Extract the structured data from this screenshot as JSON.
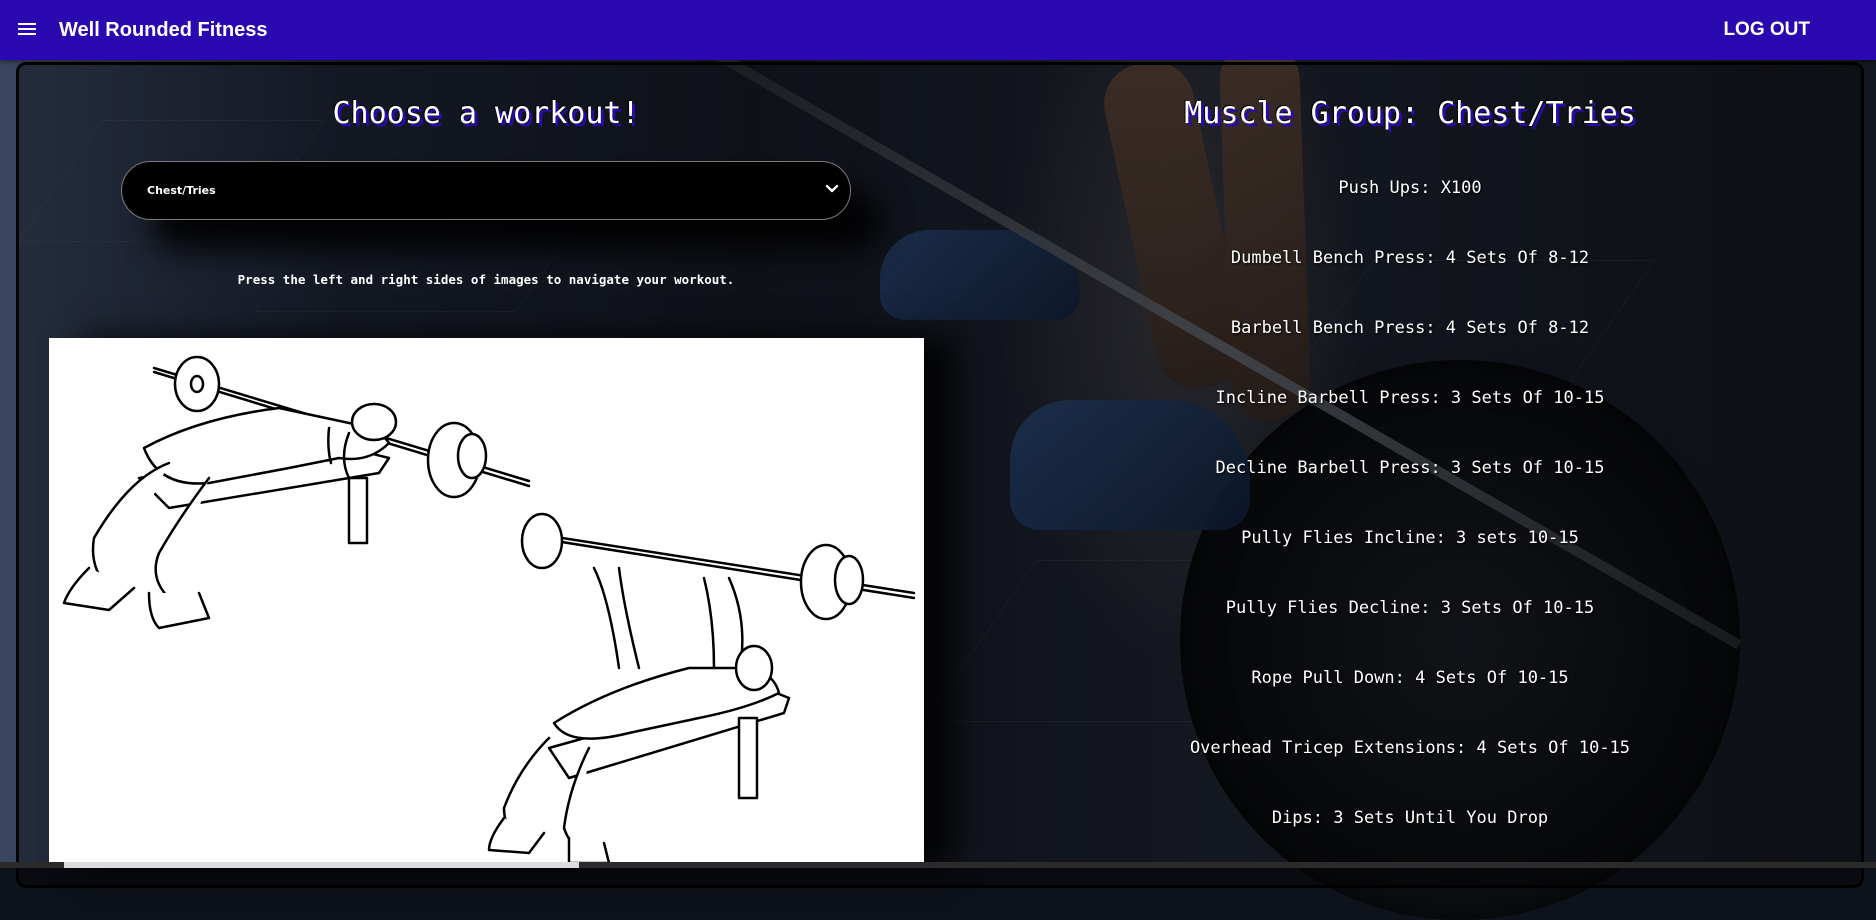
{
  "appbar": {
    "menu_icon": "hamburger-menu-icon",
    "brand": "Well Rounded Fitness",
    "logout_label": "LOG OUT",
    "color": "#2a0ab0"
  },
  "workout_picker": {
    "title": "Choose a workout!",
    "selected": "Chest/Tries",
    "dropdown_icon": "chevron-down-icon",
    "hint": "Press the left and right sides of images to navigate your workout."
  },
  "workout_image": {
    "description_icon": "barbell-bench-press-illustration"
  },
  "muscle_group": {
    "title": "Muscle Group: Chest/Tries",
    "exercises": [
      "Push Ups: X100",
      "Dumbell Bench Press: 4 Sets Of 8-12",
      "Barbell Bench Press: 4 Sets Of 8-12",
      "Incline Barbell Press: 3 Sets Of 10-15",
      "Decline Barbell Press: 3 Sets Of 10-15",
      "Pully Flies Incline: 3 sets 10-15",
      "Pully Flies Decline: 3 Sets Of 10-15",
      "Rope Pull Down: 4 Sets Of 10-15",
      "Overhead Tricep Extensions: 4 Sets Of 10-15",
      "Dips: 3 Sets Until You Drop"
    ]
  }
}
